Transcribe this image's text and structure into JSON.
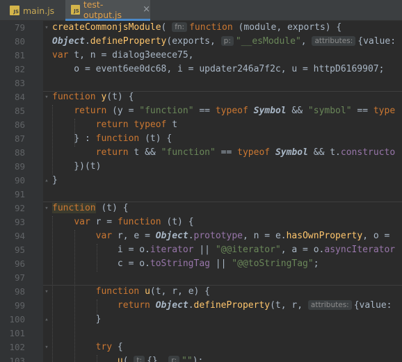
{
  "tabs": [
    {
      "icon": "JS",
      "label": "main.js",
      "active": false
    },
    {
      "icon": "JS",
      "label": "test-output.js",
      "active": true,
      "close": "×"
    }
  ],
  "lines": [
    {
      "n": "79",
      "html": "<span class=\"f\">createCommonjsModule</span>( <span class=\"hint\">fn:</span><span class=\"k\">function</span> (module, exports) {"
    },
    {
      "n": "80",
      "html": "<span class=\"b\">Object</span>.<span class=\"f\">defineProperty</span>(exports, <span class=\"hint\">p:</span><span class=\"s\">\"__esModule\"</span>, <span class=\"hint\">attributes:</span>{value:"
    },
    {
      "n": "81",
      "html": "<span class=\"k\">var</span> t, n = dialog3eeece75,"
    },
    {
      "n": "82",
      "html": "    o = event6ee0dc68, i = updater246a7f2c, u = httpD6169907;"
    },
    {
      "n": "83",
      "html": ""
    },
    {
      "n": "84",
      "html": "<span class=\"k\">function</span> <span class=\"f\">y</span>(t) {"
    },
    {
      "n": "85",
      "html": "    <span class=\"k\">return</span> (y = <span class=\"s\">\"function\"</span> == <span class=\"k\">typeof</span> <span class=\"b\">Symbol</span> && <span class=\"s\">\"symbol\"</span> == <span class=\"k\">type</span>"
    },
    {
      "n": "86",
      "html": "        <span class=\"k\">return typeof</span> t"
    },
    {
      "n": "87",
      "html": "    } : <span class=\"k\">function</span> (t) {"
    },
    {
      "n": "88",
      "html": "        <span class=\"k\">return</span> t && <span class=\"s\">\"function\"</span> == <span class=\"k\">typeof</span> <span class=\"b\">Symbol</span> && t.<span class=\"p\">constructo</span>"
    },
    {
      "n": "89",
      "html": "    })(t)"
    },
    {
      "n": "90",
      "html": "}"
    },
    {
      "n": "91",
      "html": ""
    },
    {
      "n": "92",
      "html": "<span class=\"hl\">function</span> (t) {"
    },
    {
      "n": "93",
      "html": "    <span class=\"k\">var</span> r = <span class=\"k\">function</span> (t) {"
    },
    {
      "n": "94",
      "html": "        <span class=\"k\">var</span> r, e = <span class=\"b\">Object</span>.<span class=\"p\">prototype</span>, n = e.<span class=\"f\">hasOwnProperty</span>, o = "
    },
    {
      "n": "95",
      "html": "            i = o.<span class=\"p\">iterator</span> || <span class=\"s\">\"@@iterator\"</span>, a = o.<span class=\"p\">asyncIterator</span>"
    },
    {
      "n": "96",
      "html": "            c = o.<span class=\"p\">toStringTag</span> || <span class=\"s\">\"@@toStringTag\"</span>;"
    },
    {
      "n": "97",
      "html": ""
    },
    {
      "n": "98",
      "html": "        <span class=\"k\">function</span> <span class=\"f\">u</span>(t, r, e) {"
    },
    {
      "n": "99",
      "html": "            <span class=\"k\">return</span> <span class=\"b\">Object</span>.<span class=\"f\">defineProperty</span>(t, r, <span class=\"hint\">attributes:</span>{value:"
    },
    {
      "n": "100",
      "html": "        }"
    },
    {
      "n": "101",
      "html": ""
    },
    {
      "n": "102",
      "html": "        <span class=\"k\">try</span> {"
    },
    {
      "n": "103",
      "html": "            <span class=\"f\">u</span>( <span class=\"hint\">t:</span>{}, <span class=\"hint\">r:</span><span class=\"s\">\"\"</span>);"
    }
  ]
}
